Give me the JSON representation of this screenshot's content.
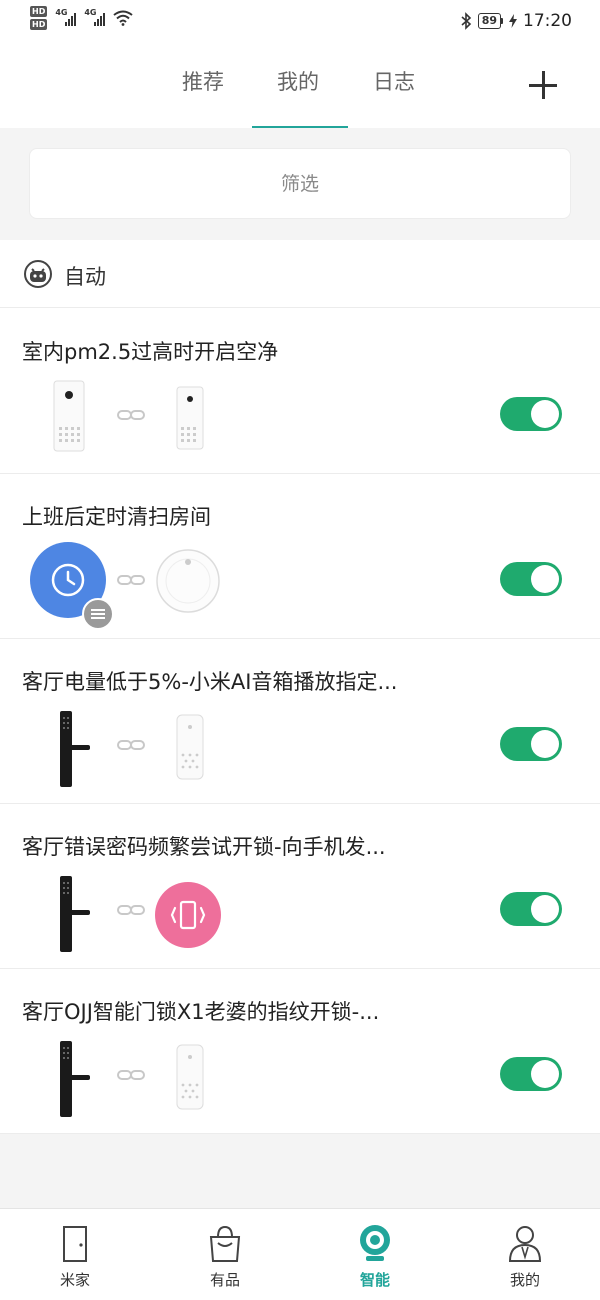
{
  "status_bar": {
    "hd1": "HD",
    "hd2": "HD",
    "net1": "4G",
    "net2": "4G",
    "battery": "89",
    "time": "17:20"
  },
  "tabs": [
    {
      "label": "推荐"
    },
    {
      "label": "我的",
      "active": true
    },
    {
      "label": "日志"
    }
  ],
  "filter": {
    "label": "筛选"
  },
  "section": {
    "title": "自动",
    "icon": "robot-icon"
  },
  "automations": [
    {
      "title": "室内pm2.5过高时开启空净",
      "trigger": "air-purifier-icon",
      "action": "air-purifier-icon",
      "enabled": true
    },
    {
      "title": "上班后定时清扫房间",
      "trigger": "clock-icon",
      "action": "robot-vacuum-icon",
      "enabled": true
    },
    {
      "title": "客厅电量低于5%-小米AI音箱播放指定...",
      "trigger": "door-lock-icon",
      "action": "ai-speaker-icon",
      "enabled": true
    },
    {
      "title": "客厅错误密码频繁尝试开锁-向手机发...",
      "trigger": "door-lock-icon",
      "action": "phone-notify-icon",
      "enabled": true
    },
    {
      "title": "客厅OJJ智能门锁X1老婆的指纹开锁-...",
      "trigger": "door-lock-icon",
      "action": "ai-speaker-icon",
      "enabled": true
    }
  ],
  "bottom_nav": [
    {
      "label": "米家",
      "icon": "door-icon"
    },
    {
      "label": "有品",
      "icon": "shopping-bag-icon"
    },
    {
      "label": "智能",
      "icon": "smart-camera-icon",
      "active": true
    },
    {
      "label": "我的",
      "icon": "profile-icon"
    }
  ],
  "colors": {
    "accent": "#22a59a",
    "toggle_on": "#1faa6e",
    "clock_blue": "#4e86e3",
    "notify_pink": "#ee6f9b"
  }
}
